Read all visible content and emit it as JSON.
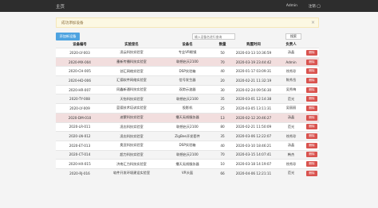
{
  "navbar": {
    "brand": "主页",
    "user": "Admin",
    "logout": "注销 ◯"
  },
  "alert": {
    "message": "成功添加设备",
    "close": "×"
  },
  "toolbar": {
    "add_label": "添加新设备",
    "search_placeholder": "输入设备名进行查询",
    "search_label": "搜索"
  },
  "table": {
    "headers": [
      "设备编号",
      "实验室名",
      "设备名",
      "数量",
      "购置时间",
      "负责人",
      ""
    ],
    "delete_label": "删除",
    "rows": [
      {
        "id": "2020-LY-003",
        "lab": "凌云科技实验室",
        "device": "专业VR眼镜",
        "qty": "50",
        "date": "2020-03-13 10:36:59",
        "owner": "汤晶"
      },
      {
        "id": "2020-MX-004",
        "lab": "墨新传播科技实验室",
        "device": "联想启天2100",
        "qty": "70",
        "date": "2020-03-19 23:44:42",
        "owner": "Admin"
      },
      {
        "id": "2020-CH-005",
        "lab": "创汇网络实验室",
        "device": "DSP实验箱",
        "qty": "40",
        "date": "2020-01-17 03:09:31",
        "owner": "徐秀珍"
      },
      {
        "id": "2020-HD-006",
        "lab": "汇德软件网络实验室",
        "device": "信号发生器",
        "qty": "20",
        "date": "2020-02-21 11:32:19",
        "owner": "陈秀岳"
      },
      {
        "id": "2020-HR-007",
        "lab": "同鑫新通科技实验室",
        "device": "双踪示波器",
        "qty": "30",
        "date": "2020-02-24 09:56:30",
        "owner": "吴秀梅"
      },
      {
        "id": "2020-TY-008",
        "lab": "天怡科技实验室",
        "device": "联想启天2100",
        "qty": "35",
        "date": "2020-03-01 12:14:38",
        "owner": "范光"
      },
      {
        "id": "2020-LY-009",
        "lab": "蓝德技术培训实验室",
        "device": "投影机",
        "qty": "25",
        "date": "2020-03-05 13:11:31",
        "owner": "吴丽丽"
      },
      {
        "id": "2020-DM-010",
        "lab": "迪蒙科技实验室",
        "device": "播天无线服务器",
        "qty": "13",
        "date": "2020-02-12 20:46:27",
        "owner": "汤晶"
      },
      {
        "id": "2020-LR-011",
        "lab": "凌志科技实验室",
        "device": "联想启天2100",
        "qty": "80",
        "date": "2020-02-21 11:50:09",
        "owner": "范光"
      },
      {
        "id": "2020-LN-012",
        "lab": "凌志科技实验室",
        "device": "ZigBee开发套件",
        "qty": "35",
        "date": "2020-03-06 12:22:07",
        "owner": "徐秀珍"
      },
      {
        "id": "2020-ET-013",
        "lab": "奥亚科技实验室",
        "device": "DSP实验箱",
        "qty": "40",
        "date": "2020-03-10 18:46:21",
        "owner": "汤晶"
      },
      {
        "id": "2020-CT-014",
        "lab": "超力科技实验室",
        "device": "联想启天2100",
        "qty": "70",
        "date": "2020-03-15 14:07:41",
        "owner": "韩杰"
      },
      {
        "id": "2020-HX-015",
        "lab": "济南汇力科技实验室",
        "device": "播天无线服务器",
        "qty": "10",
        "date": "2020-03-18 14:19:07",
        "owner": "徐秀珍"
      },
      {
        "id": "2020-RJ-016",
        "lab": "软件开发环境建设实验室",
        "device": "VR头盔",
        "qty": "66",
        "date": "2020-04-06 12:21:11",
        "owner": "范光"
      }
    ]
  }
}
